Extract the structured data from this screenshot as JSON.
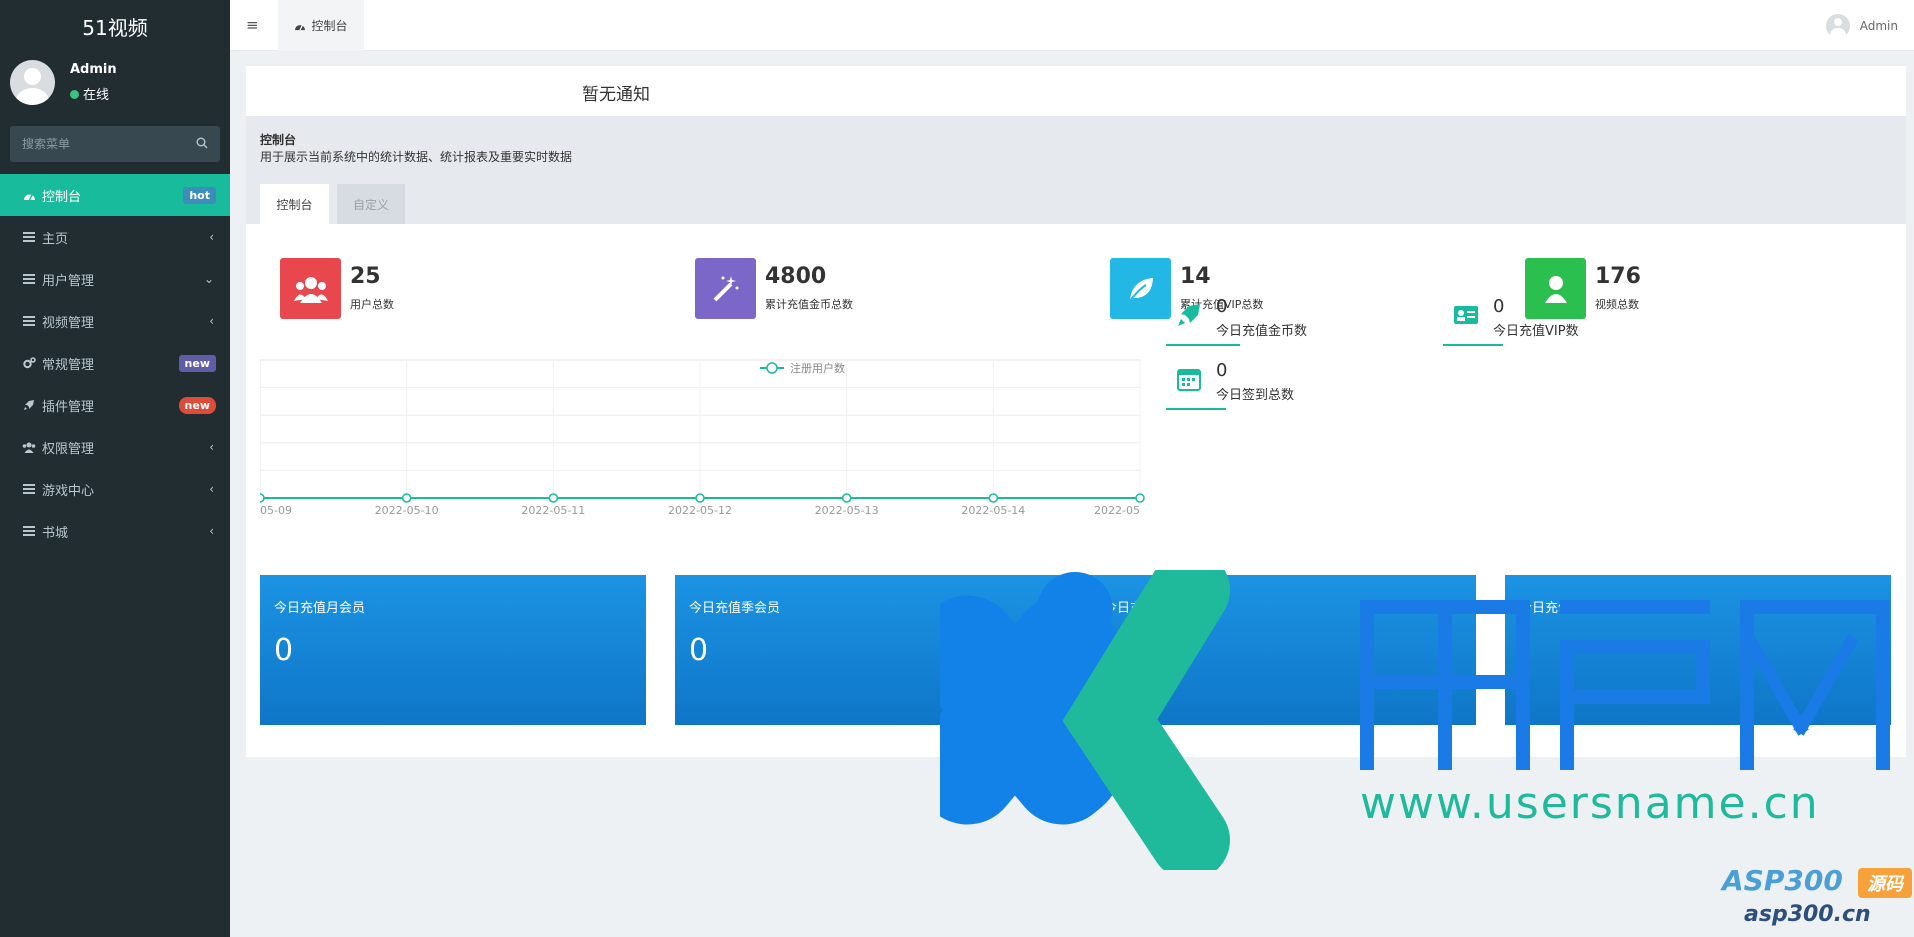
{
  "sidebar": {
    "logo": "51视频",
    "user_name": "Admin",
    "user_status": "在线",
    "search_placeholder": "搜索菜单",
    "items": [
      {
        "label": "控制台",
        "badge": "hot",
        "icon": "dashboard-icon"
      },
      {
        "label": "主页",
        "icon": "list-icon"
      },
      {
        "label": "用户管理",
        "icon": "list-icon"
      },
      {
        "label": "视频管理",
        "icon": "list-icon"
      },
      {
        "label": "常规管理",
        "badge": "new",
        "icon": "gears-icon"
      },
      {
        "label": "插件管理",
        "badge": "new",
        "icon": "rocket-icon"
      },
      {
        "label": "权限管理",
        "icon": "users-icon"
      },
      {
        "label": "游戏中心",
        "icon": "list-icon"
      },
      {
        "label": "书城",
        "icon": "list-icon"
      }
    ]
  },
  "topbar": {
    "tab_label": "控制台",
    "user_name": "Admin"
  },
  "notice": {
    "text": "暂无通知"
  },
  "panel": {
    "title": "控制台",
    "description": "用于展示当前系统中的统计数据、统计报表及重要实时数据",
    "tabs": [
      "控制台",
      "自定义"
    ]
  },
  "stats": [
    {
      "value": "25",
      "label": "用户总数",
      "icon": "users-icon",
      "color": "#e8484d"
    },
    {
      "value": "4800",
      "label": "累计充值金币总数",
      "icon": "magic-wand-icon",
      "color": "#7a67c7"
    },
    {
      "value": "14",
      "label": "累计充值VIP总数",
      "icon": "leaf-icon",
      "color": "#23b7e5"
    },
    {
      "value": "176",
      "label": "视频总数",
      "icon": "user-icon",
      "color": "#2bbf4f"
    }
  ],
  "side_stats": [
    {
      "value": "0",
      "label": "今日充值金币数",
      "icon": "rocket-icon"
    },
    {
      "value": "0",
      "label": "今日充值VIP数",
      "icon": "id-card-icon"
    },
    {
      "value": "0",
      "label": "今日签到总数",
      "icon": "calendar-icon"
    }
  ],
  "tiles": [
    {
      "label": "今日充值月会员",
      "value": "0"
    },
    {
      "label": "今日充值季会员",
      "value": "0"
    },
    {
      "label": "今日充值",
      "value": ""
    },
    {
      "label": "今日充值永久会员",
      "value": ""
    }
  ],
  "watermarks": {
    "url_main": "www.usersname.cn",
    "asp_label": "ASP300",
    "asp_suffix": "源码",
    "asp_domain": "asp300.cn"
  },
  "chart_data": {
    "type": "line",
    "categories": [
      "05-09",
      "2022-05-10",
      "2022-05-11",
      "2022-05-12",
      "2022-05-13",
      "2022-05-14",
      "2022-05"
    ],
    "series": [
      {
        "name": "注册用户数",
        "values": [
          0,
          0,
          0,
          0,
          0,
          0,
          0
        ]
      }
    ],
    "legend": "top-center",
    "grid": true
  },
  "colors": {
    "sidebar_bg": "#222d32",
    "accent": "#18bc9c",
    "tile_blue": "#1a8ddb"
  }
}
